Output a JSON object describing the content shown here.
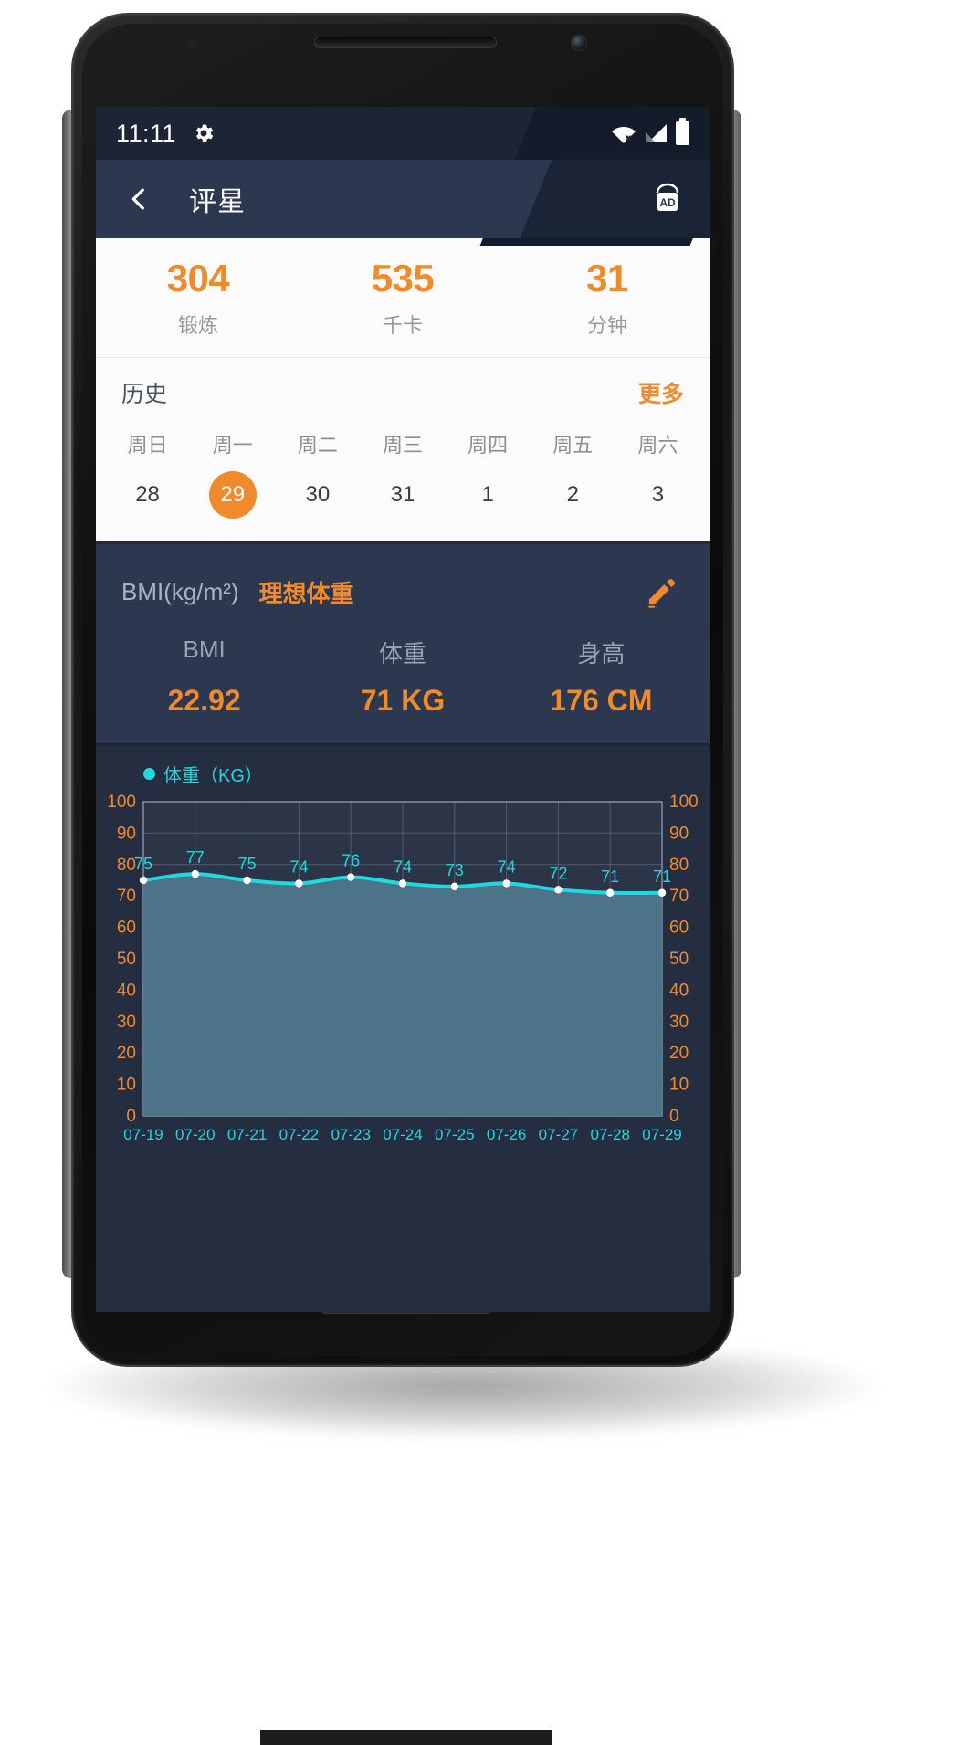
{
  "status_bar": {
    "time": "11:11",
    "gear_icon": "gear-icon",
    "wifi_icon": "wifi-off-icon",
    "signal_icon": "cellular-signal-icon",
    "battery_icon": "battery-full-icon"
  },
  "app_bar": {
    "back_icon": "back-chevron-icon",
    "title": "评星",
    "ad_icon": "ad-badge-icon",
    "ad_label": "AD"
  },
  "stats": [
    {
      "value": "304",
      "label": "锻炼"
    },
    {
      "value": "535",
      "label": "千卡"
    },
    {
      "value": "31",
      "label": "分钟"
    }
  ],
  "history": {
    "title": "历史",
    "more_label": "更多",
    "weekdays": [
      "周日",
      "周一",
      "周二",
      "周三",
      "周四",
      "周五",
      "周六"
    ],
    "dates": [
      "28",
      "29",
      "30",
      "31",
      "1",
      "2",
      "3"
    ],
    "selected_index": 1
  },
  "bmi": {
    "unit_label": "BMI(kg/m²)",
    "ideal_label": "理想体重",
    "edit_icon": "pencil-edit-icon",
    "labels": [
      "BMI",
      "体重",
      "身高"
    ],
    "values": [
      "22.92",
      "71 KG",
      "176 CM"
    ]
  },
  "colors": {
    "accent_orange": "#f08a2b",
    "chart_cyan": "#1fd8e0",
    "card_dark": "#2c3750",
    "screen_bg": "#232c3d",
    "appbar_dark_diag": "#1b2436"
  },
  "chart_data": {
    "type": "area",
    "title": "",
    "legend": [
      "体重（KG）"
    ],
    "legend_position": "top-left",
    "series": [
      {
        "name": "体重（KG）",
        "values": [
          75,
          77,
          75,
          74,
          76,
          74,
          73,
          74,
          72,
          71,
          71
        ]
      }
    ],
    "x": [
      "07-19",
      "07-20",
      "07-21",
      "07-22",
      "07-23",
      "07-24",
      "07-25",
      "07-26",
      "07-27",
      "07-28",
      "07-29"
    ],
    "xlabel": "",
    "ylabel": "",
    "ylim": [
      0,
      100
    ],
    "yticks": [
      0,
      10,
      20,
      30,
      40,
      50,
      60,
      70,
      80,
      90,
      100
    ],
    "y_axis_left_labels": [
      "100",
      "90",
      "80",
      "70",
      "60",
      "50",
      "40",
      "30",
      "20",
      "10",
      "0"
    ],
    "y_axis_right_labels": [
      "100",
      "90",
      "80",
      "70",
      "60",
      "50",
      "40",
      "30",
      "20",
      "10",
      "0"
    ],
    "grid": true,
    "point_labels": [
      "75",
      "77",
      "75",
      "74",
      "76",
      "74",
      "73",
      "74",
      "72",
      "71",
      "71"
    ]
  },
  "nav_bar": {
    "back_icon": "nav-back-triangle-icon",
    "home_icon": "nav-home-circle-icon",
    "recents_icon": "nav-recents-square-icon"
  }
}
